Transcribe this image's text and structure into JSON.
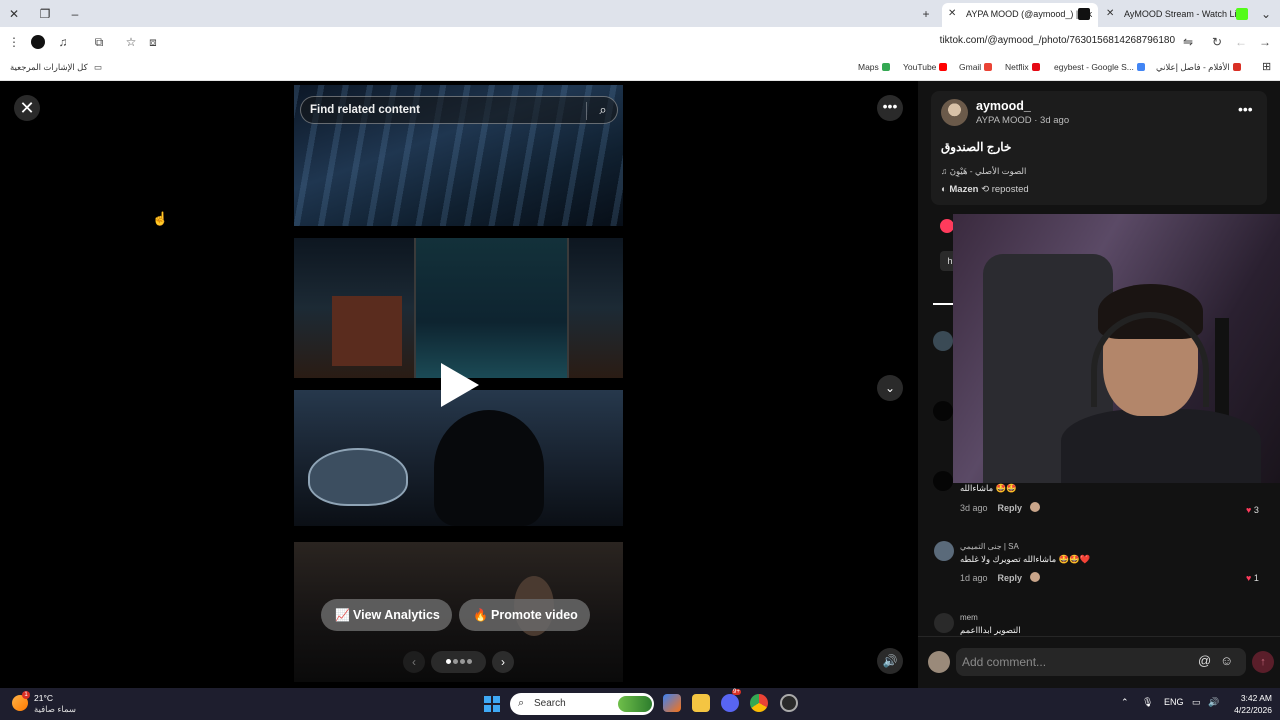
{
  "browser": {
    "tabs": [
      {
        "label": "AYPA MOOD (@aymood_) | Tik",
        "active": true
      },
      {
        "label": "AyMOOD Stream - Watch Live",
        "active": false
      }
    ],
    "url": "tiktok.com/@aymood_/photo/7630156814268796180",
    "bookmarks": {
      "all_bookmarks": "كل الإشارات المرجعية",
      "items": [
        "Maps",
        "YouTube",
        "Gmail",
        "Netflix",
        "egybest - Google S...",
        "الأفلام - فاصل إعلاني"
      ]
    }
  },
  "viewer": {
    "search_label": "Find related content",
    "buttons": {
      "view_analytics": "View Analytics",
      "promote_video": "Promote video"
    },
    "slides": {
      "total": 4,
      "current": 1
    }
  },
  "post": {
    "username": "aymood_",
    "display_name": "AYPA MOOD",
    "time": "3d ago",
    "meta_line": "AYPA MOOD · 3d ago",
    "caption": "خارج الصندوق",
    "sound": "الصوت الأصلي - هَيْوِنَ",
    "repost_user": "Mazen",
    "repost_label": "reposted",
    "stub_hash": "h"
  },
  "comments": [
    {
      "name": "",
      "text": "ماشاءالله 🤩🤩",
      "time": "3d ago",
      "reply": "Reply",
      "likes": "3"
    },
    {
      "name": "جنى التميمي | SA",
      "text": "ماشاءالله تصويرك ولا غلطه 🤩🤩❤️",
      "time": "1d ago",
      "reply": "Reply",
      "likes": "1"
    },
    {
      "name": "mem",
      "text": "التصوير ابداااعمم"
    }
  ],
  "add_comment": {
    "placeholder": "Add comment..."
  },
  "taskbar": {
    "temperature": "21°C",
    "weather": "سماء صافية",
    "search": "Search",
    "language": "ENG",
    "time": "3:42 AM",
    "date": "4/22/2026",
    "badge": "1",
    "discord_badge": "9+"
  },
  "colors": {
    "accent": "#ff3b5c",
    "panel_bg": "#121212",
    "card_bg": "#1c1c1c"
  }
}
